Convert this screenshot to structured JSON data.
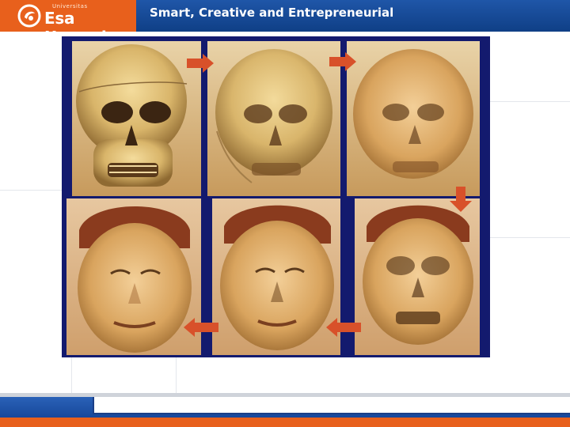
{
  "header": {
    "logo_small": "Universitas",
    "logo_name": "Esa Unggul",
    "tagline": "Smart, Creative and Entrepreneurial"
  },
  "colors": {
    "brand_orange": "#e8601c",
    "brand_blue": "#174a9c",
    "photo_frame": "#131a6e",
    "arrow_red": "#d8512a"
  },
  "figure": {
    "description_icons": [
      "skull",
      "skull-face-overlay",
      "skull-face-overlay",
      "skull-face-overlay",
      "face-reconstruction-overlay",
      "face-reconstruction"
    ],
    "arrows": [
      "arrow-right",
      "arrow-right",
      "arrow-down",
      "arrow-left",
      "arrow-left"
    ]
  }
}
